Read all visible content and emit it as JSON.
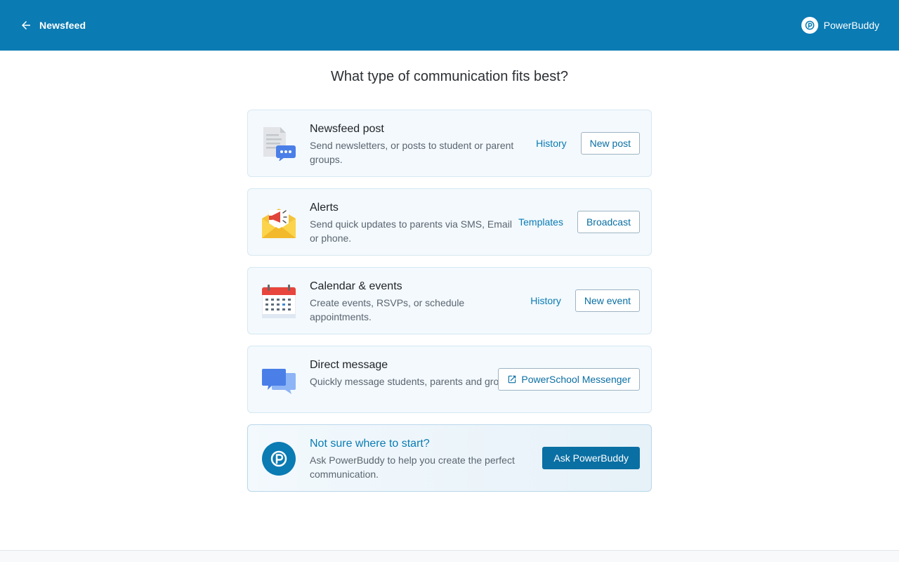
{
  "header": {
    "back_label": "Newsfeed",
    "brand_name": "PowerBuddy",
    "background_color": "#0a7bb3"
  },
  "page": {
    "heading": "What type of communication fits best?"
  },
  "options": [
    {
      "title": "Newsfeed post",
      "description": "Send newsletters, or posts to student or parent groups.",
      "icon": "newsfeed-document-chat-icon",
      "link_label": "History",
      "button_label": "New post"
    },
    {
      "title": "Alerts",
      "description": "Send quick updates to parents via SMS, Email or phone.",
      "icon": "envelope-megaphone-icon",
      "link_label": "Templates",
      "button_label": "Broadcast"
    },
    {
      "title": "Calendar & events",
      "description": "Create events, RSVPs, or schedule appointments.",
      "icon": "calendar-icon",
      "link_label": "History",
      "button_label": "New event"
    },
    {
      "title": "Direct message",
      "description": "Quickly message students, parents and groups.",
      "icon": "chat-bubbles-icon",
      "button_label": "PowerSchool Messenger",
      "button_icon": "external-link-icon"
    }
  ],
  "help": {
    "title": "Not sure where to start?",
    "description": "Ask PowerBuddy to help you create the perfect communication.",
    "icon": "powerbuddy-logo-icon",
    "button_label": "Ask PowerBuddy"
  },
  "colors": {
    "accent": "#0a7bb3",
    "card_background": "#f3f9fd",
    "card_border": "#d7e8f2"
  }
}
